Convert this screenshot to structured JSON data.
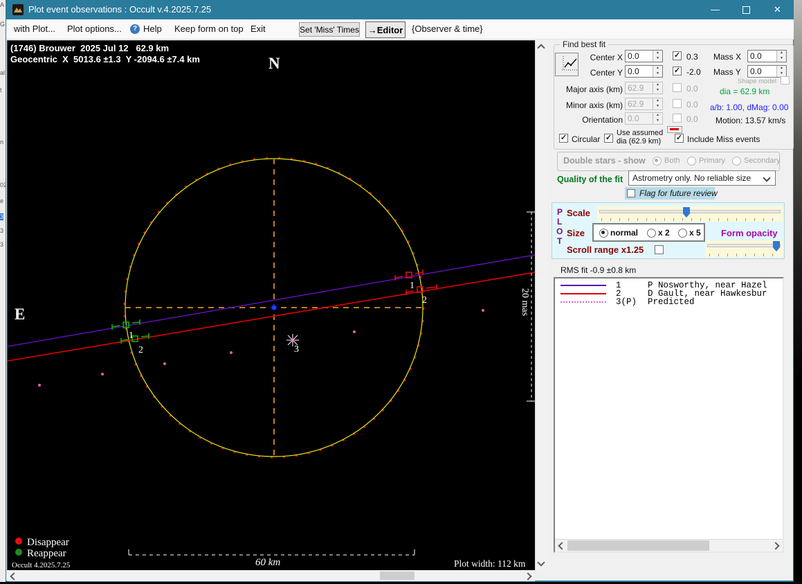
{
  "window": {
    "title": "Plot event observations : Occult v.4.2025.7.25",
    "minimize": "—",
    "close": "✕"
  },
  "menu": {
    "with_plot": "with Plot...",
    "plot_options": "Plot options...",
    "help": "Help",
    "keep_on_top": "Keep form on top",
    "exit": "Exit",
    "set_miss_times": "Set 'Miss' Times",
    "editor": "→Editor",
    "observer_time": "{Observer & time}"
  },
  "plot": {
    "header_line1": "(1746) Brouwer  2025 Jul 12   62.9 km",
    "header_line2": "Geocentric  X  5013.6 ±1.3  Y -2094.6 ±7.4 km",
    "north": "N",
    "east": "E",
    "legend_disappear": "Disappear",
    "legend_reappear": "Reappear",
    "version": "Occult 4.2025.7.25",
    "scale_bar_km": "60 km",
    "plot_width": "Plot width: 112 km",
    "scale_bar_mas": "20 mas",
    "markers": {
      "left": [
        "1",
        "2"
      ],
      "right": [
        "1",
        "2"
      ],
      "star": "3"
    }
  },
  "find_best_fit": {
    "title": "Find best fit",
    "center_x_label": "Center X",
    "center_x_value": "0.0",
    "center_x_check": "0.3",
    "center_y_label": "Center Y",
    "center_y_value": "0.0",
    "center_y_check": "-2.0",
    "mass_x_label": "Mass X",
    "mass_x_value": "0.0",
    "mass_y_label": "Mass Y",
    "mass_y_value": "0.0",
    "shape_model": "Shape model",
    "major_axis_label": "Major axis (km)",
    "major_axis_value": "62.9",
    "major_axis_check": "0.0",
    "minor_axis_label": "Minor axis (km)",
    "minor_axis_value": "62.9",
    "minor_axis_check": "0.0",
    "dia": "dia = 62.9 km",
    "ab": "a/b: 1.00, dMag: 0.00",
    "orientation_label": "Orientation",
    "orientation_value": "0.0",
    "orientation_check": "0.0",
    "motion": "Motion: 13.57 km/s",
    "circular": "Circular",
    "use_assumed_1": "Use assumed",
    "use_assumed_2": "dia (62.9 km)",
    "include_miss": "Include Miss events"
  },
  "double_stars": {
    "title": "Double stars - show",
    "both": "Both",
    "primary": "Primary",
    "secondary": "Secondary"
  },
  "quality": {
    "label": "Quality of the fit",
    "value": "Astrometry only. No reliable size",
    "flag": "Flag for future review"
  },
  "plot_controls": {
    "p": "P",
    "l": "L",
    "o": "O",
    "t": "T",
    "scale": "Scale",
    "size": "Size",
    "size_normal": "normal",
    "size_x2": "x 2",
    "size_x5": "x 5",
    "form_opacity": "Form opacity",
    "scroll_range": "Scroll range x1.25"
  },
  "rms_fit": "RMS fit -0.9 ±0.8 km",
  "observers": {
    "rows": [
      {
        "num": "1",
        "name": "P Nosworthy, near Hazel"
      },
      {
        "num": "2",
        "name": "D Gault, near Hawkesbur"
      },
      {
        "num": "3(P)",
        "name": "Predicted"
      }
    ]
  },
  "colors": {
    "titlebar": "#2b7b9c",
    "circle_fit": "#e8e81a",
    "circle_assumed_dashes": "#dd1111",
    "crosshair": "#c08018",
    "chord1_purple": "#5a10a8",
    "chord2_red": "#e00000",
    "predicted_pink": "#e55bbd",
    "disappear_red": "#e01010",
    "reappear_green": "#1f8c1f",
    "quality_green": "#007820",
    "dia_green": "#00a53c",
    "ab_blue": "#2020ff"
  }
}
